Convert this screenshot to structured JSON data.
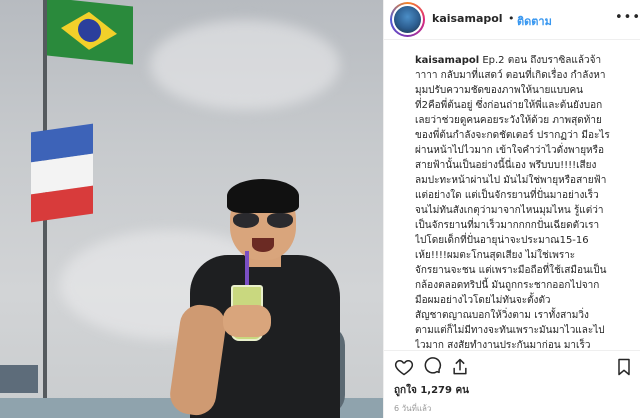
{
  "post": {
    "username": "kaisamapol",
    "header_separator": "•",
    "follow_label": "ติดตาม",
    "more_label": "•••",
    "caption_username": "kaisamapol",
    "caption_text": " Ep.2 ตอน ถึงบราซิลแล้วจ้า\nาาาา กลับมาที่แสดว์ ตอนที่เกิดเรื่อง กำลังหา\nมุมปรับความชัดของภาพให้นายแบบคน\nที่2คือพี่ต้นอยู่ ซึ่งก่อนถ่ายให้พี่และต้นยังบอก\nเลยว่าช่วยดูคนคอยระวังให้ด้วย ภาพสุดท้าย\nของพี่ต้นกำลังจะกดชัตเตอร์ ปรากฏว่า มีอะไร\nผ่านหน้าไปไวมาก เข้าใจคำว่าไวดั่งพายุหรือ\nสายฟ้านั้นเป็นอย่างนี้นี่เอง พรึบบบ!!!!เสียง\nลมปะทะหน้าผ่านไป มันไม่ใช่พายุหรือสายฟ้า\nแต่อย่างใด แต่เป็นจักรยานที่ปั่นมาอย่างเร็ว\nจนไม่ทันสังเกตุว่ามาจากไหนมุมไหน รู้แต่ว่า\nเป็นจักรยานที่มาเร็วมากกกกปั่นเฉียดตัวเรา\nไปโดยเด็กที่ปั่นอายุน่าจะประมาณ15-16\nเห้ย!!!!ผมตะโกนสุดเสียง ไม่ใช่เพราะ\nจักรยานจะชน แต่เพราะมือถือที่ใช้เสมือนเป็น\nกล้องตลอดทริปนี้ มันถูกกระชากออกไปจาก\nมือผมอย่างไวโดยไม่ทันจะตั้งตัว\nสัญชาตญาณบอกให้วิ่งตาม เราทั้งสามวิ่ง\nตามแต่ก็ไม่มีทางจะทันเพราะมันมาไวและไป\nไวมาก สงสัยทำงานประกันมาก่อน มาเร็ว",
    "likes_text": "ถูกใจ 1,279 คน",
    "time_text": "6 วันที่แล้ว"
  },
  "icons": {
    "like": "heart-icon",
    "comment": "comment-icon",
    "share": "share-icon",
    "save": "bookmark-icon"
  },
  "colors": {
    "follow": "#3897f0",
    "text": "#262626",
    "muted": "#999999"
  }
}
